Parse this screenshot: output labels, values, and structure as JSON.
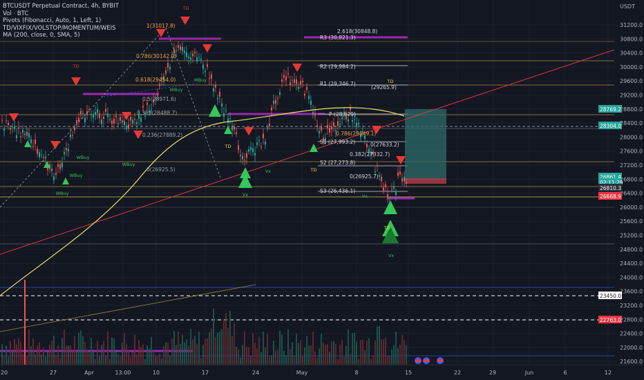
{
  "header": {
    "symbol": "BTCUSDT Perpetual Contract, 4h, BYBIT",
    "indicators": [
      "Vol · BTC",
      "Pivots (Fibonacci, Auto, 1, Left, 1)",
      "TD/VIXFIX/VOLSTOP/MOMENTUM/WEIS",
      "MA (200, close, 0, SMA, 5)"
    ],
    "currency": "USDT"
  },
  "y_axis": {
    "ticks": [
      "31200.0",
      "30800.0",
      "30400.0",
      "30000.0",
      "29600.0",
      "29200.0",
      "28800.0",
      "28400.0",
      "28000.0",
      "27600.0",
      "27200.0",
      "26800.0",
      "26400.0",
      "26000.0",
      "25600.0",
      "25200.0",
      "24800.0",
      "24400.0",
      "24000.0",
      "23600.0",
      "23200.0",
      "22800.0",
      "22400.0",
      "22000.0",
      "21600.0"
    ],
    "price_labels": [
      {
        "text": "28769.2",
        "color": "#26a69a"
      },
      {
        "text": "28304.0",
        "color": "#26a69a"
      },
      {
        "text": "26861.4",
        "color": "#26a69a"
      },
      {
        "text": "02:11:29",
        "color": "#26a69a"
      },
      {
        "text": "26810.3",
        "color": "#2a2e39"
      },
      {
        "text": "26668.9",
        "color": "#f23645"
      },
      {
        "text": "23450.0",
        "color": "#ffffff"
      },
      {
        "text": "22763.0",
        "color": "#f23645"
      }
    ]
  },
  "x_axis": {
    "ticks": [
      "20",
      "27",
      "Apr",
      "13:00",
      "10",
      "17",
      "24",
      "May",
      "8",
      "15",
      "22",
      "29",
      "Jun",
      "6",
      "12"
    ]
  },
  "pivot_labels": [
    "2.618(30848.8)",
    "R3 (30,821.3)",
    "R2 (29,984.2)",
    "R1 (29,346.7)",
    "(29265.9)",
    "P (28,629)",
    "0.786(28049.1)",
    "S1 (27,993.2)",
    "0(27633.2)",
    "0.382(27332.7)",
    "S2 (27,273.8)",
    "0(26925.7)",
    "S3 (26,436.1)"
  ],
  "fib_labels": [
    "1(31017.8)",
    "0.786(30142.0)",
    "0.618(29454.0)",
    "0.5(28971.6)",
    "0.382(28488.7)",
    "0.236(27889.2)",
    "0(26925.5)"
  ],
  "markers": [
    "TD",
    "TD",
    "TD",
    "TD",
    "TD",
    "TD",
    "WBuy",
    "WBuy",
    "WBuy",
    "WBuy",
    "WBuy",
    "MBuy",
    "Vx",
    "Vx",
    "Vx",
    "Vx"
  ],
  "colors": {
    "background": "#131722",
    "grid": "#1e222d",
    "up": "#26a69a",
    "down": "#ef5350",
    "ma": "#e8e36a",
    "fib": "#f0a23a",
    "pivot": "#ffffff",
    "purple": "#9c27b0",
    "trend": "#f23645",
    "target": "#2e6b69"
  }
}
